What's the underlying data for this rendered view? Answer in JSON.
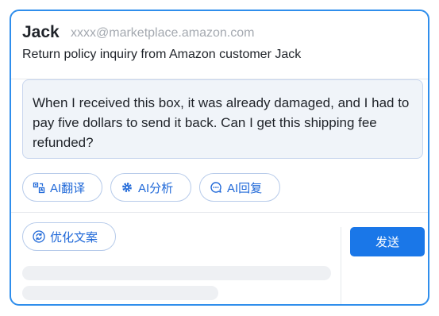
{
  "sender": {
    "name": "Jack",
    "email": "xxxx@marketplace.amazon.com"
  },
  "subject": "Return policy inquiry from Amazon customer Jack",
  "message": "When I received this box, it was already damaged, and I had to pay five dollars to send it back. Can I get this shipping fee refunded?",
  "ai_actions": [
    {
      "label": "AI翻译",
      "icon": "translate-icon"
    },
    {
      "label": "AI分析",
      "icon": "gear-icon"
    },
    {
      "label": "AI回复",
      "icon": "chat-bubble-icon"
    }
  ],
  "composer": {
    "optimize_label": "优化文案",
    "optimize_icon": "refresh-icon",
    "send_label": "发送"
  },
  "colors": {
    "accent": "#1a77e8",
    "border": "#2f8eec",
    "message_bg": "#f0f4f9"
  }
}
